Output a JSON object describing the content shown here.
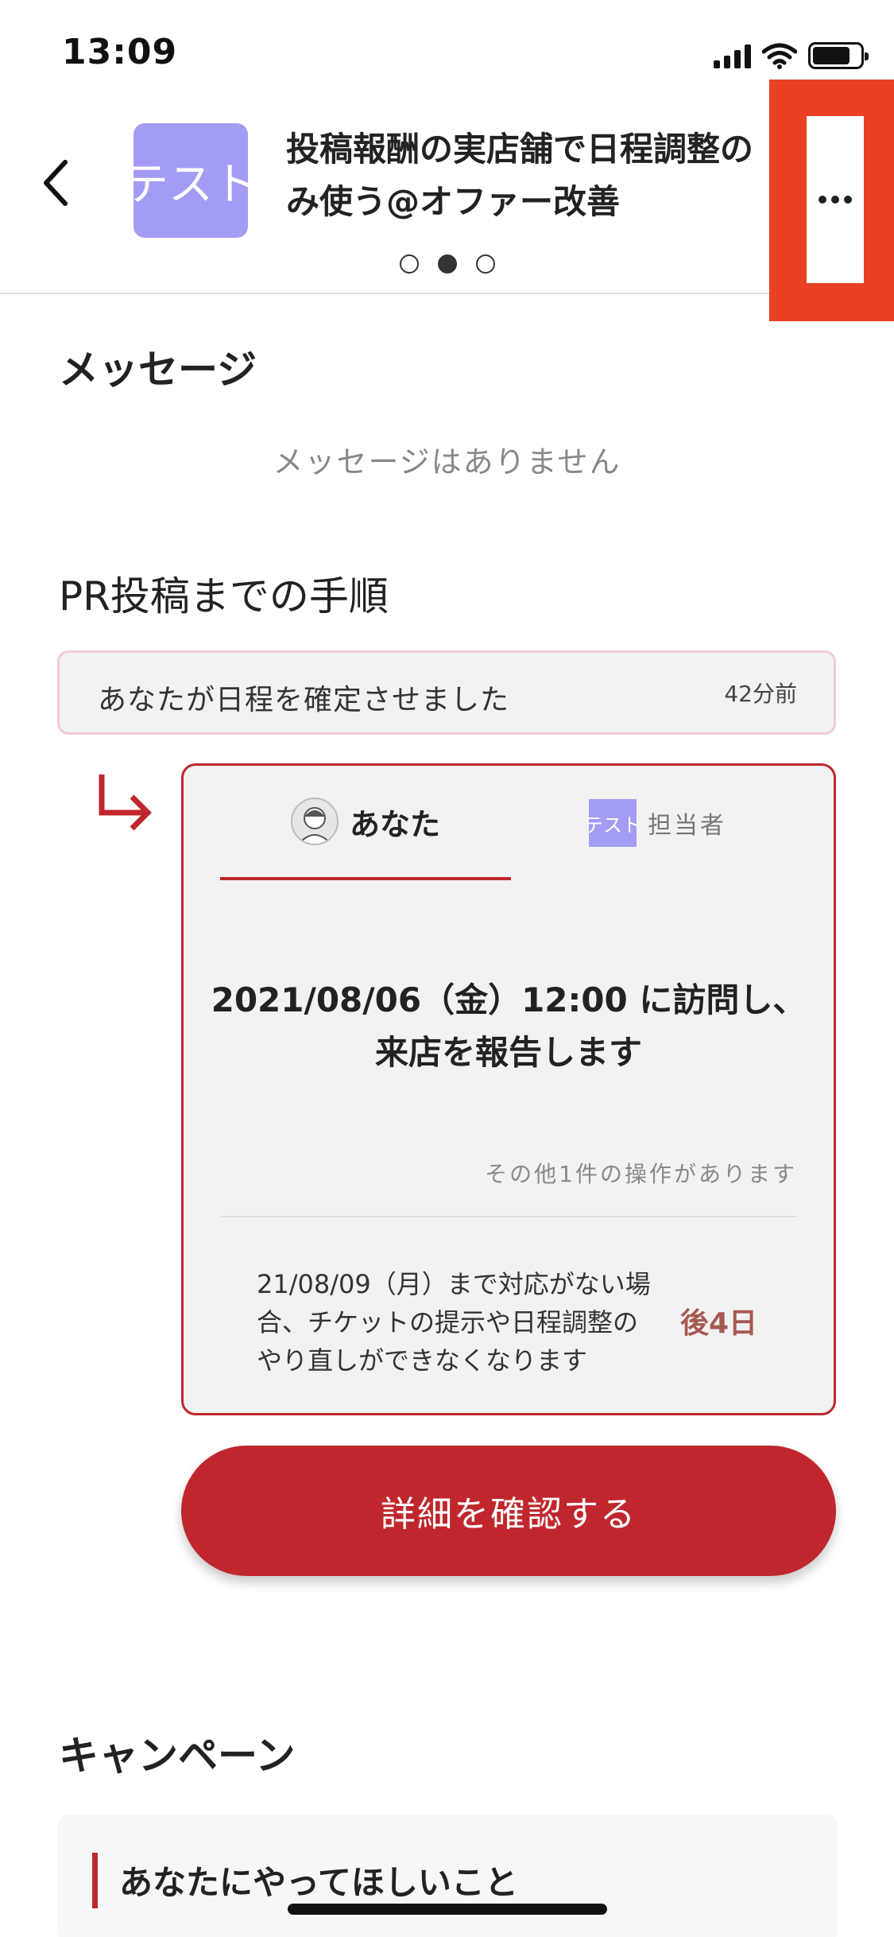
{
  "status_bar": {
    "time": "13:09"
  },
  "header": {
    "shop_thumb_text": "テスト",
    "title": "投稿報酬の実店舗で日程調整の\nみ使う@オファー改善",
    "pager": {
      "count": 3,
      "active_index": 1
    }
  },
  "messages": {
    "title": "メッセージ",
    "empty_text": "メッセージはありません"
  },
  "steps": {
    "title": "PR投稿までの手順",
    "completed_step": {
      "text": "あなたが日程を確定させました",
      "time": "42分前"
    },
    "card": {
      "tab_you": "あなた",
      "tab_staff_thumb": "テスト",
      "tab_staff": "担当者",
      "main_line1": "2021/08/06（金）12:00 に訪問し、",
      "main_line2": "来店を報告します",
      "other_actions": "その他1件の操作があります",
      "deadline": "21/08/09（月）まで対応がない場\n合、チケットの提示や日程調整の\nやり直しができなくなります",
      "remaining": "後4日"
    },
    "confirm_button": "詳細を確認する"
  },
  "campaign": {
    "title": "キャンペーン",
    "card_text": "あなたにやってほしいこと"
  },
  "colors": {
    "accent": "#c0272d",
    "highlight": "#ea4024",
    "thumb": "#a39cf4",
    "remaining_text": "#a65a52"
  },
  "icons": [
    "back-icon",
    "more-icon",
    "arrow-down-right-icon",
    "avatar-icon"
  ]
}
